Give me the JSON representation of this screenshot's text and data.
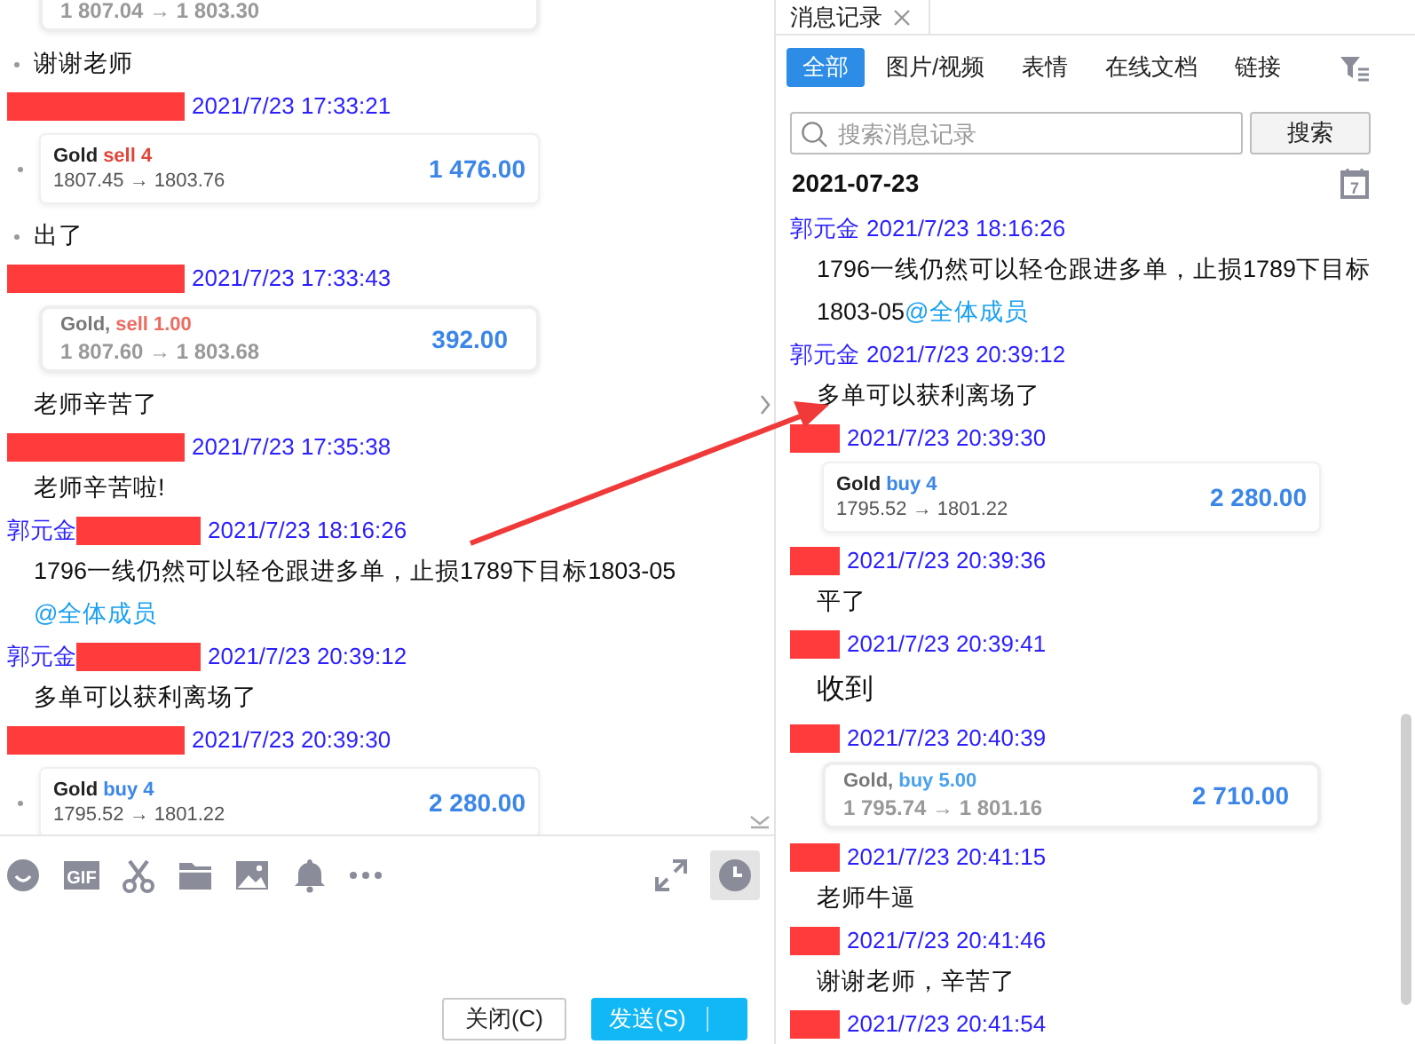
{
  "chat": {
    "messages": [
      {
        "kind": "summary",
        "route": "1 807.04 → 1 803.30",
        "dot": false
      },
      {
        "kind": "text",
        "text": "谢谢老师",
        "dot": true
      },
      {
        "kind": "header",
        "redacted": true,
        "time": "2021/7/23 17:33:21"
      },
      {
        "kind": "trade",
        "pair": "Gold",
        "order": "sell 4",
        "color": "#e0453a",
        "route": "1807.45 → 1803.76",
        "amount": "1 476.00",
        "dot": true
      },
      {
        "kind": "text",
        "text": "出了",
        "dot": true
      },
      {
        "kind": "header",
        "redacted": true,
        "time": "2021/7/23 17:33:43"
      },
      {
        "kind": "summary",
        "pair": "Gold,",
        "order": "sell 1.00",
        "color": "#ec6b60",
        "route": "1 807.60 → 1 803.68",
        "amount": "392.00",
        "dot": false
      },
      {
        "kind": "text",
        "text": "老师辛苦了",
        "dot": false
      },
      {
        "kind": "header",
        "redacted": true,
        "time": "2021/7/23 17:35:38"
      },
      {
        "kind": "text",
        "text": "老师辛苦啦!",
        "dot": false
      },
      {
        "kind": "header",
        "sender": "郭元金",
        "redacted": true,
        "time": "2021/7/23 18:16:26"
      },
      {
        "kind": "text",
        "text": "1796一线仍然可以轻仓跟进多单，止损1789下目标1803-05",
        "dot": false
      },
      {
        "kind": "mention",
        "text": "@全体成员"
      },
      {
        "kind": "header",
        "sender": "郭元金",
        "redacted": true,
        "time": "2021/7/23 20:39:12"
      },
      {
        "kind": "text",
        "text": "多单可以获利离场了",
        "dot": false
      },
      {
        "kind": "header",
        "redacted": true,
        "time": "2021/7/23 20:39:30"
      },
      {
        "kind": "trade",
        "pair": "Gold",
        "order": "buy 4",
        "color": "#3b86e8",
        "route": "1795.52 → 1801.22",
        "amount": "2 280.00",
        "dot": true
      }
    ],
    "toolbar": {
      "gif_label": "GIF",
      "history_on": true
    },
    "buttons": [
      {
        "label": "关闭(C)",
        "kind": "secondary"
      },
      {
        "label": "发送(S)",
        "kind": "primary"
      }
    ]
  },
  "history": {
    "tab_title": "消息记录",
    "filters": [
      {
        "label": "全部",
        "selected": true
      },
      {
        "label": "图片/视频",
        "selected": false
      },
      {
        "label": "表情",
        "selected": false
      },
      {
        "label": "在线文档",
        "selected": false
      },
      {
        "label": "链接",
        "selected": false
      }
    ],
    "search": {
      "placeholder": "搜索消息记录",
      "button": "搜索"
    },
    "date": "2021-07-23",
    "calendar_day": "7",
    "messages": [
      {
        "kind": "header",
        "sender": "郭元金",
        "redacted": false,
        "time": "2021/7/23 18:16:26"
      },
      {
        "kind": "text",
        "text": "1796一线仍然可以轻仓跟进多单，止损1789下目标1803-05",
        "mention": "@全体成员"
      },
      {
        "kind": "header",
        "sender": "郭元金",
        "redacted": false,
        "time": "2021/7/23 20:39:12"
      },
      {
        "kind": "text",
        "text": "多单可以获利离场了"
      },
      {
        "kind": "header",
        "redacted": true,
        "time": "2021/7/23 20:39:30"
      },
      {
        "kind": "trade",
        "pair": "Gold",
        "order": "buy 4",
        "color": "#3b86e8",
        "route": "1795.52 → 1801.22",
        "amount": "2 280.00"
      },
      {
        "kind": "header",
        "redacted": true,
        "time": "2021/7/23 20:39:36"
      },
      {
        "kind": "text",
        "text": "平了"
      },
      {
        "kind": "header",
        "redacted": true,
        "time": "2021/7/23 20:39:41"
      },
      {
        "kind": "text",
        "text": "收到",
        "large": true
      },
      {
        "kind": "header",
        "redacted": true,
        "time": "2021/7/23 20:40:39"
      },
      {
        "kind": "summary",
        "pair": "Gold,",
        "order": "buy 5.00",
        "color": "#4aa2ee",
        "route": "1 795.74 → 1 801.16",
        "amount": "2 710.00"
      },
      {
        "kind": "header",
        "redacted": true,
        "time": "2021/7/23 20:41:15"
      },
      {
        "kind": "text",
        "text": "老师牛逼"
      },
      {
        "kind": "header",
        "redacted": true,
        "time": "2021/7/23 20:41:46"
      },
      {
        "kind": "text",
        "text": "谢谢老师，辛苦了"
      },
      {
        "kind": "header",
        "redacted": true,
        "time": "2021/7/23 20:41:54"
      }
    ]
  }
}
